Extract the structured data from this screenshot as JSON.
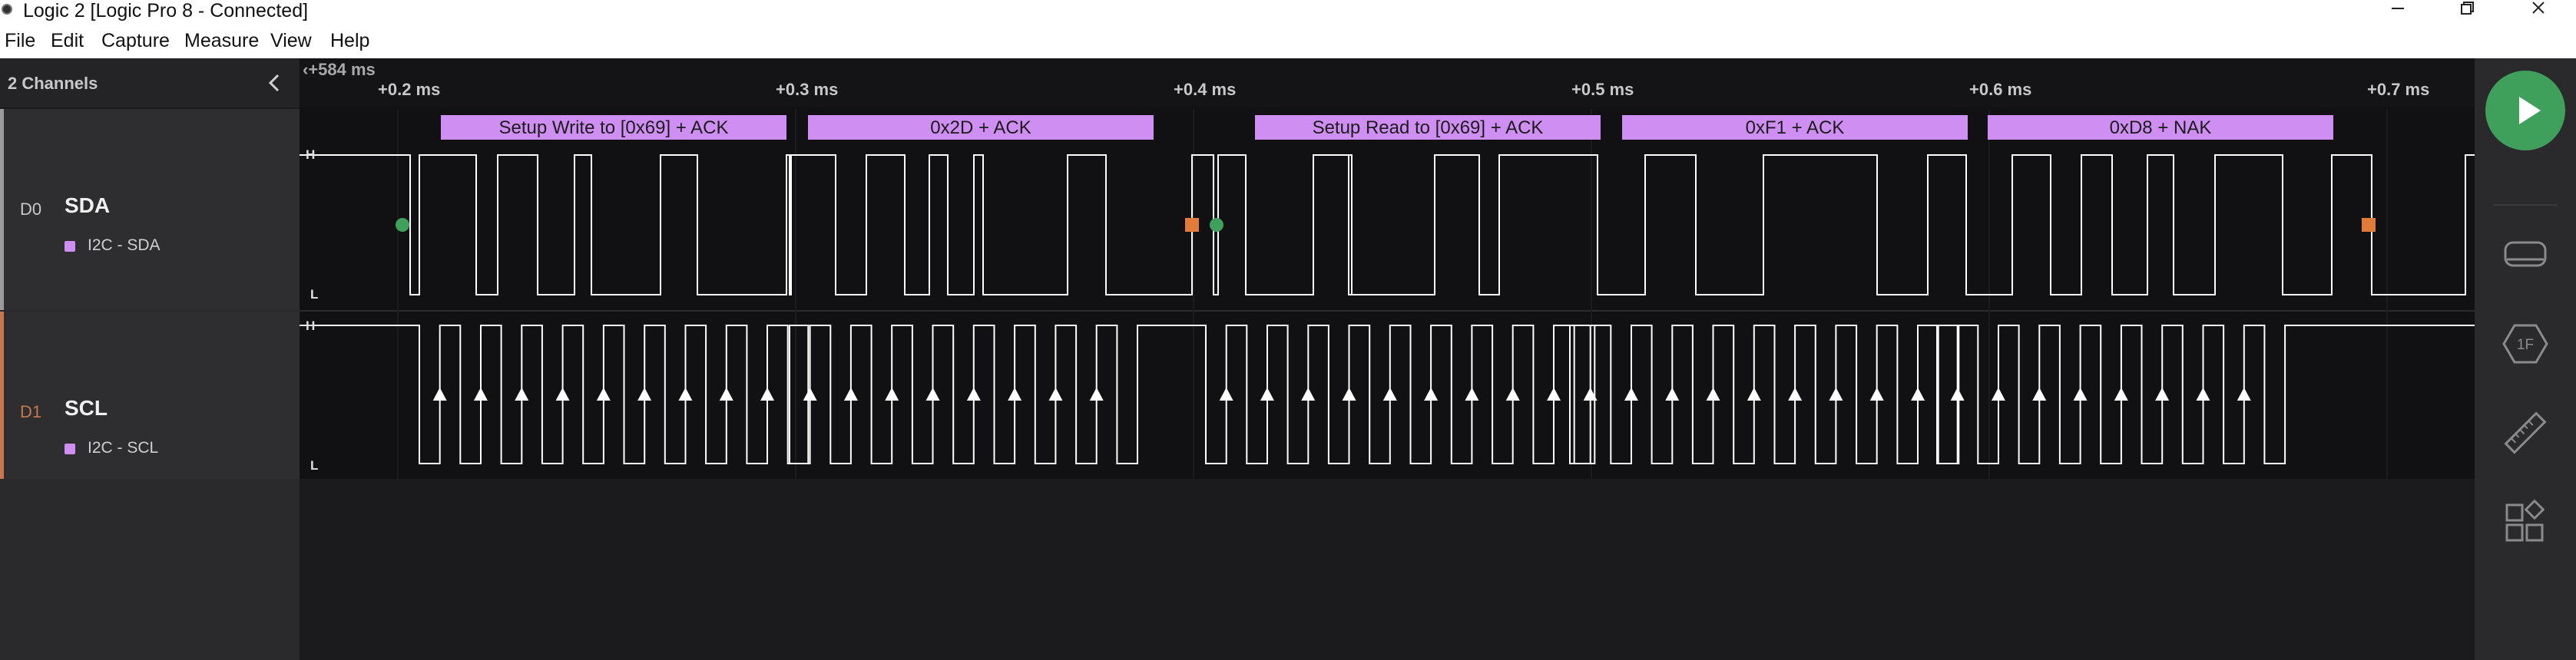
{
  "window": {
    "title": "Logic 2 [Logic Pro 8 - Connected]"
  },
  "menu": [
    "File",
    "Edit",
    "Capture",
    "Measure",
    "View",
    "Help"
  ],
  "sidebar": {
    "channel_count_label": "2 Channels",
    "channels": [
      {
        "index": "D0",
        "name": "SDA",
        "analyzer": "I2C - SDA",
        "accent": "#9b9b9b"
      },
      {
        "index": "D1",
        "name": "SCL",
        "analyzer": "I2C - SCL",
        "accent": "#c8784a"
      }
    ]
  },
  "timeline": {
    "offset": "+584 ms",
    "ticks": [
      "+0.2 ms",
      "+0.3 ms",
      "+0.4 ms",
      "+0.5 ms",
      "+0.6 ms",
      "+0.7 ms"
    ]
  },
  "trace": {
    "high_label": "H",
    "low_label": "L"
  },
  "decoded_frames": [
    "Setup Write to [0x69] + ACK",
    "0x2D + ACK",
    "Setup Read to [0x69] + ACK",
    "0xF1 + ACK",
    "0xD8 + NAK"
  ],
  "colors": {
    "accent_play": "#3fa05b",
    "frame": "#cf8ef2",
    "start_marker": "#3fa05b",
    "stop_marker": "#e07b39"
  },
  "right_toolbar": {
    "icons": [
      "play-icon",
      "annotations-icon",
      "analyzers-icon",
      "measure-icon",
      "extensions-icon"
    ]
  }
}
